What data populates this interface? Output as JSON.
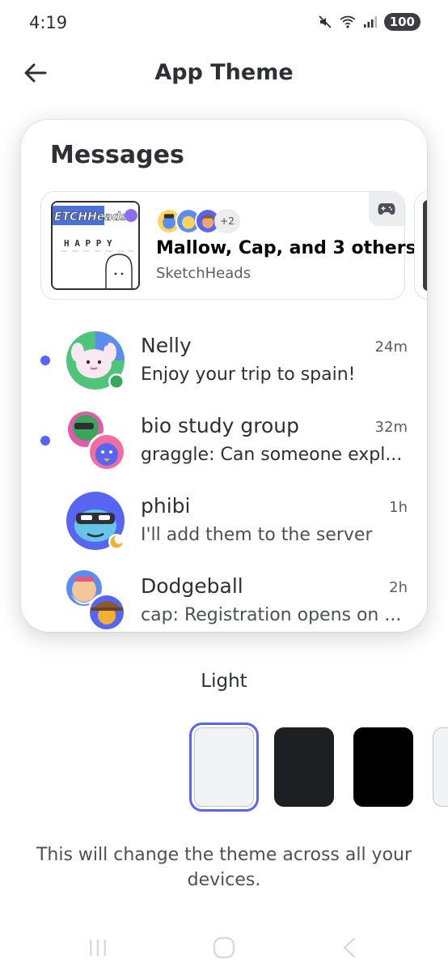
{
  "status_bar": {
    "time": "4:19",
    "battery": "100",
    "icons": [
      "mute-icon",
      "wifi-icon",
      "signal-icon",
      "battery-icon"
    ]
  },
  "header": {
    "title": "App Theme",
    "back_icon": "arrow-left-icon"
  },
  "preview": {
    "heading": "Messages",
    "activity": {
      "title": "Mallow, Cap, and 3 others",
      "subtitle": "SketchHeads",
      "extra_count": "+2",
      "thumbnail_logo": "ETCHHeads",
      "thumbnail_word": "H A P P Y",
      "icon": "game-controller-icon"
    },
    "dms": [
      {
        "name": "Nelly",
        "time": "24m",
        "preview": "Enjoy your trip to spain!",
        "unread": true,
        "status": "online"
      },
      {
        "name": "bio study group",
        "time": "32m",
        "preview": "graggle: Can someone expl...",
        "unread": true,
        "status": "group"
      },
      {
        "name": "phibi",
        "time": "1h",
        "preview": "I'll add them to the server",
        "unread": false,
        "status": "idle"
      },
      {
        "name": "Dodgeball",
        "time": "2h",
        "preview": "cap: Registration opens on ...",
        "unread": false,
        "status": "group"
      }
    ]
  },
  "theme": {
    "selected_label": "Light",
    "swatches": [
      {
        "name": "light",
        "color": "#f2f3f5",
        "selected": true
      },
      {
        "name": "dark",
        "color": "#1e1f22",
        "selected": false
      },
      {
        "name": "amoled",
        "color": "#000000",
        "selected": false
      },
      {
        "name": "next",
        "color": "#f2f3f5",
        "selected": false
      }
    ]
  },
  "footer": {
    "note": "This will change the theme across all your devices."
  },
  "colors": {
    "accent": "#5865f2",
    "online": "#3ba55c",
    "idle": "#f0b232"
  }
}
